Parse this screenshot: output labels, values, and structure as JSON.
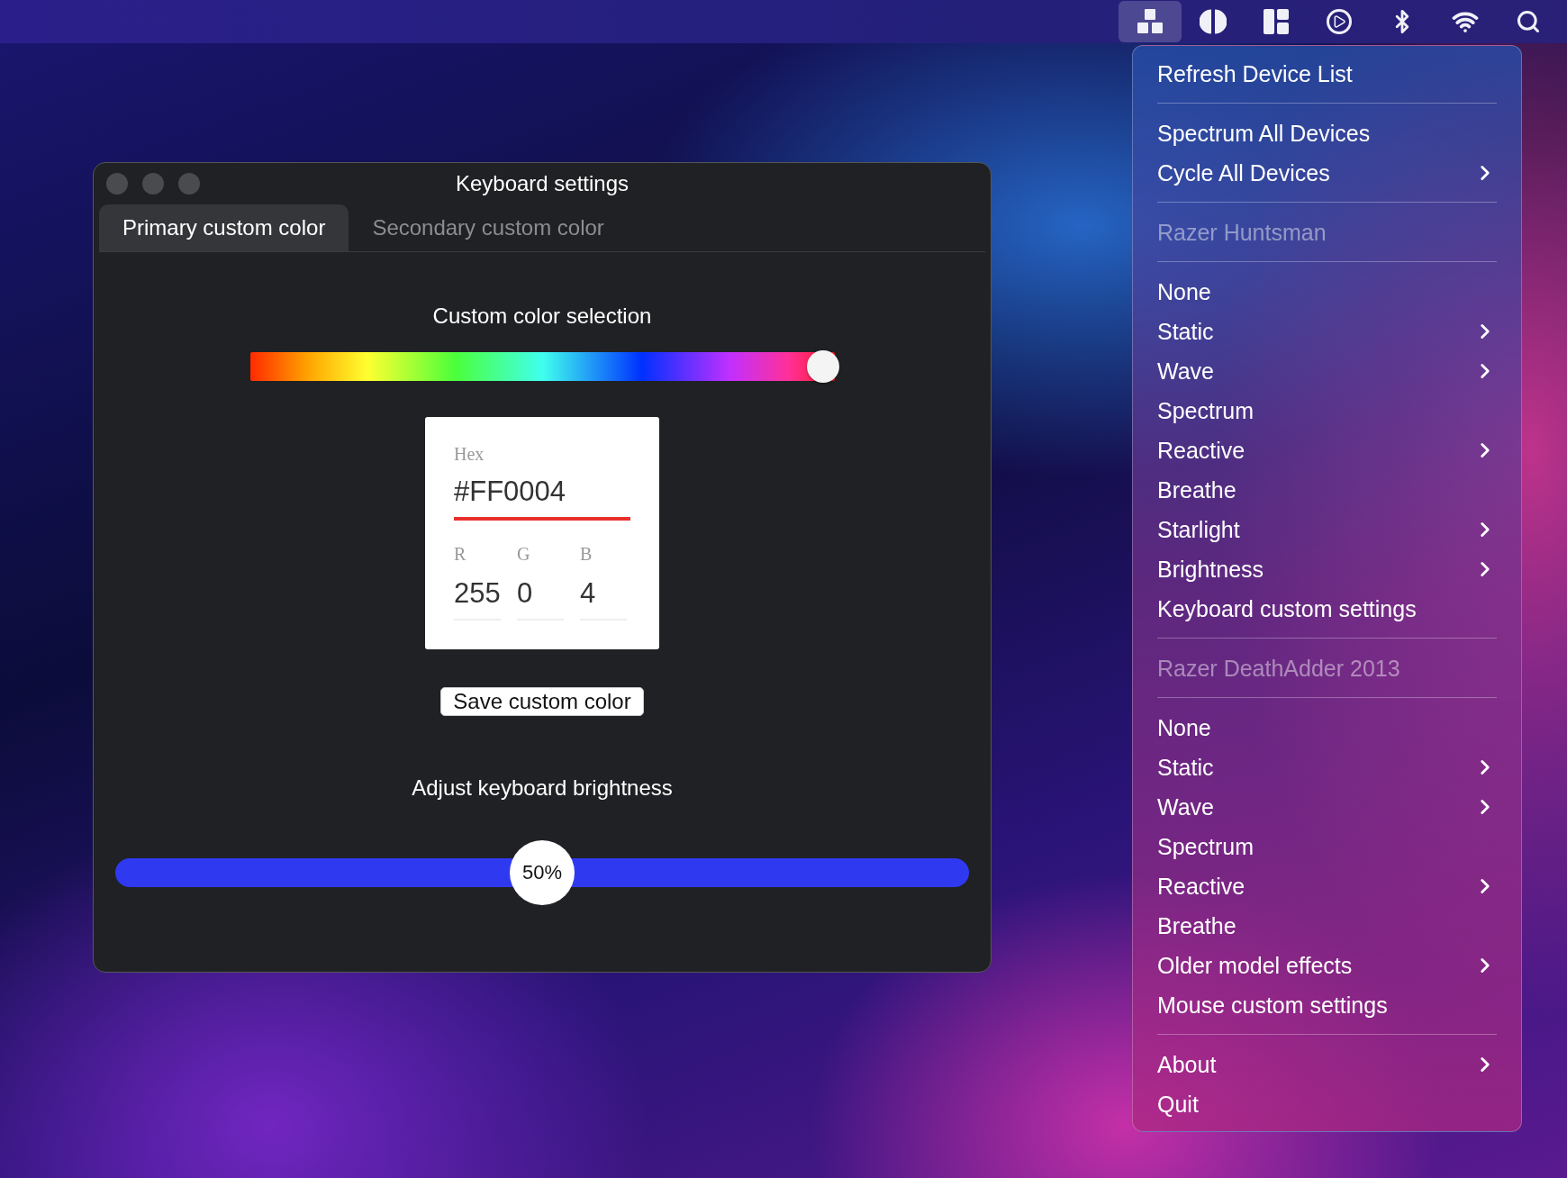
{
  "menu_bar": {
    "icons": [
      {
        "kind": "blocks",
        "selected": true
      },
      {
        "kind": "contrast",
        "selected": false
      },
      {
        "kind": "layout",
        "selected": false
      },
      {
        "kind": "play",
        "selected": false
      },
      {
        "kind": "bluetooth",
        "selected": false
      },
      {
        "kind": "wifi",
        "selected": false
      },
      {
        "kind": "search",
        "selected": false
      }
    ]
  },
  "window": {
    "title": "Keyboard settings",
    "tabs": [
      {
        "label": "Primary custom color",
        "selected": true
      },
      {
        "label": "Secondary custom color",
        "selected": false
      }
    ],
    "color_section": {
      "title": "Custom color selection",
      "level": 0.98,
      "hex_label": "Hex",
      "hex_value": "#FF0004",
      "channels": [
        {
          "label": "R",
          "value": "255"
        },
        {
          "label": "G",
          "value": "0"
        },
        {
          "label": "B",
          "value": "4"
        }
      ],
      "save_button": "Save custom color"
    },
    "brightness": {
      "title": "Adjust keyboard brightness",
      "level": 0.5,
      "reading": "50%"
    }
  },
  "menu": {
    "groups": [
      {
        "items": [
          {
            "kind": "item",
            "label": "Refresh Device List",
            "submenu": false
          }
        ]
      },
      {
        "items": [
          {
            "kind": "item",
            "label": "Spectrum All Devices",
            "submenu": false
          },
          {
            "kind": "item",
            "label": "Cycle All Devices",
            "submenu": true
          }
        ]
      },
      {
        "items": [
          {
            "kind": "header",
            "label": "Razer Huntsman",
            "submenu": false
          }
        ]
      },
      {
        "items": [
          {
            "kind": "item",
            "label": "None",
            "submenu": false
          },
          {
            "kind": "item",
            "label": "Static",
            "submenu": true
          },
          {
            "kind": "item",
            "label": "Wave",
            "submenu": true
          },
          {
            "kind": "item",
            "label": "Spectrum",
            "submenu": false
          },
          {
            "kind": "item",
            "label": "Reactive",
            "submenu": true
          },
          {
            "kind": "item",
            "label": "Breathe",
            "submenu": false
          },
          {
            "kind": "item",
            "label": "Starlight",
            "submenu": true
          },
          {
            "kind": "item",
            "label": "Brightness",
            "submenu": true
          },
          {
            "kind": "item",
            "label": "Keyboard custom settings",
            "submenu": false
          }
        ]
      },
      {
        "items": [
          {
            "kind": "header",
            "label": "Razer DeathAdder 2013",
            "submenu": false
          }
        ]
      },
      {
        "items": [
          {
            "kind": "item",
            "label": "None",
            "submenu": false
          },
          {
            "kind": "item",
            "label": "Static",
            "submenu": true
          },
          {
            "kind": "item",
            "label": "Wave",
            "submenu": true
          },
          {
            "kind": "item",
            "label": "Spectrum",
            "submenu": false
          },
          {
            "kind": "item",
            "label": "Reactive",
            "submenu": true
          },
          {
            "kind": "item",
            "label": "Breathe",
            "submenu": false
          },
          {
            "kind": "item",
            "label": "Older model effects",
            "submenu": true
          },
          {
            "kind": "item",
            "label": "Mouse custom settings",
            "submenu": false
          }
        ]
      },
      {
        "items": [
          {
            "kind": "item",
            "label": "About",
            "submenu": true
          },
          {
            "kind": "item",
            "label": "Quit",
            "submenu": false
          }
        ]
      }
    ]
  }
}
